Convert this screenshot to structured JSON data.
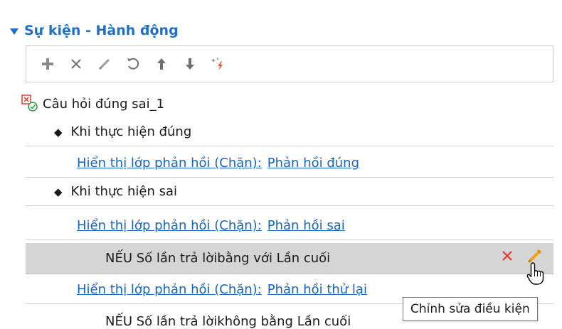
{
  "section": {
    "title": "Sự kiện - Hành động"
  },
  "toolbar": {
    "buttons": [
      {
        "icon": "plus-icon",
        "name": "add-button"
      },
      {
        "icon": "close-icon",
        "name": "delete-button"
      },
      {
        "icon": "pencil-icon",
        "name": "edit-button"
      },
      {
        "icon": "undo-icon",
        "name": "undo-button"
      },
      {
        "icon": "arrow-up-icon",
        "name": "move-up-button"
      },
      {
        "icon": "arrow-down-icon",
        "name": "move-down-button"
      },
      {
        "icon": "spark-icon",
        "name": "magic-button"
      }
    ]
  },
  "tree": {
    "root_label": "Câu hỏi đúng sai_1",
    "trigger_correct": "Khi thực hiện đúng",
    "action_correct": {
      "label": "Hiển thị lớp phản hồi (Chặn):",
      "target": "Phản hồi đúng"
    },
    "trigger_wrong": "Khi thực hiện sai",
    "action_wrong": {
      "label": "Hiển thị lớp phản hồi (Chặn):",
      "target": "Phản hồi sai"
    },
    "condition_1": "NẾU Số lần trả lờibằng với Lần cuối",
    "action_retry": {
      "label": "Hiển thị lớp phản hồi (Chặn):",
      "target": "Phản hồi thử lại"
    },
    "condition_2": "NẾU Số lần trả lờikhông bằng Lần cuối"
  },
  "tooltip": {
    "text": "Chỉnh sửa điều kiện"
  },
  "colors": {
    "accent": "#1f6fc5",
    "link": "#1565c0",
    "delete_red": "#e53935",
    "edit_orange": "#f4a300",
    "selected_row": "#d5d5d5"
  }
}
